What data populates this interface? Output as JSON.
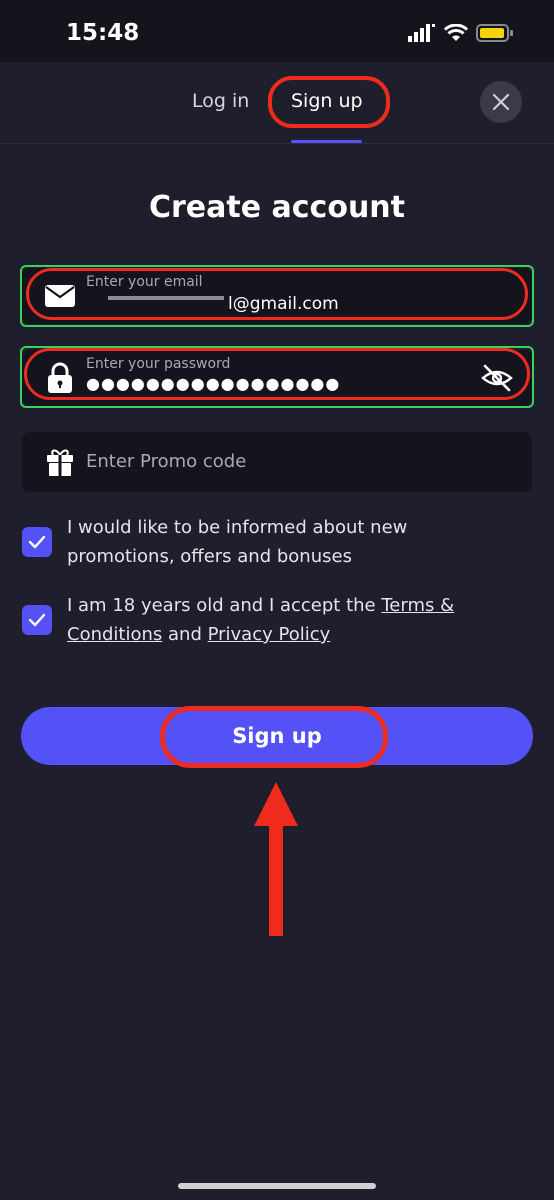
{
  "status_bar": {
    "time": "15:48"
  },
  "header": {
    "tabs": [
      {
        "label": "Log in",
        "active": false
      },
      {
        "label": "Sign up",
        "active": true
      }
    ]
  },
  "form": {
    "title": "Create account",
    "email": {
      "label": "Enter your email",
      "value": "l@gmail.com"
    },
    "password": {
      "label": "Enter your password",
      "value": "●●●●●●●●●●●●●●●●●"
    },
    "promo": {
      "placeholder": "Enter Promo code"
    },
    "checkboxes": [
      {
        "text": "I would like to be informed about new promotions, offers and bonuses",
        "checked": true
      },
      {
        "text_before": "I am 18 years old and I accept the ",
        "link1": "Terms & Conditions",
        "text_mid": " and ",
        "link2": "Privacy Policy",
        "checked": true
      }
    ],
    "submit_label": "Sign up"
  },
  "colors": {
    "background": "#1e1e2c",
    "accent": "#5452f6",
    "annotation_red": "#ef2b1e",
    "annotation_green": "#3bd15a"
  }
}
